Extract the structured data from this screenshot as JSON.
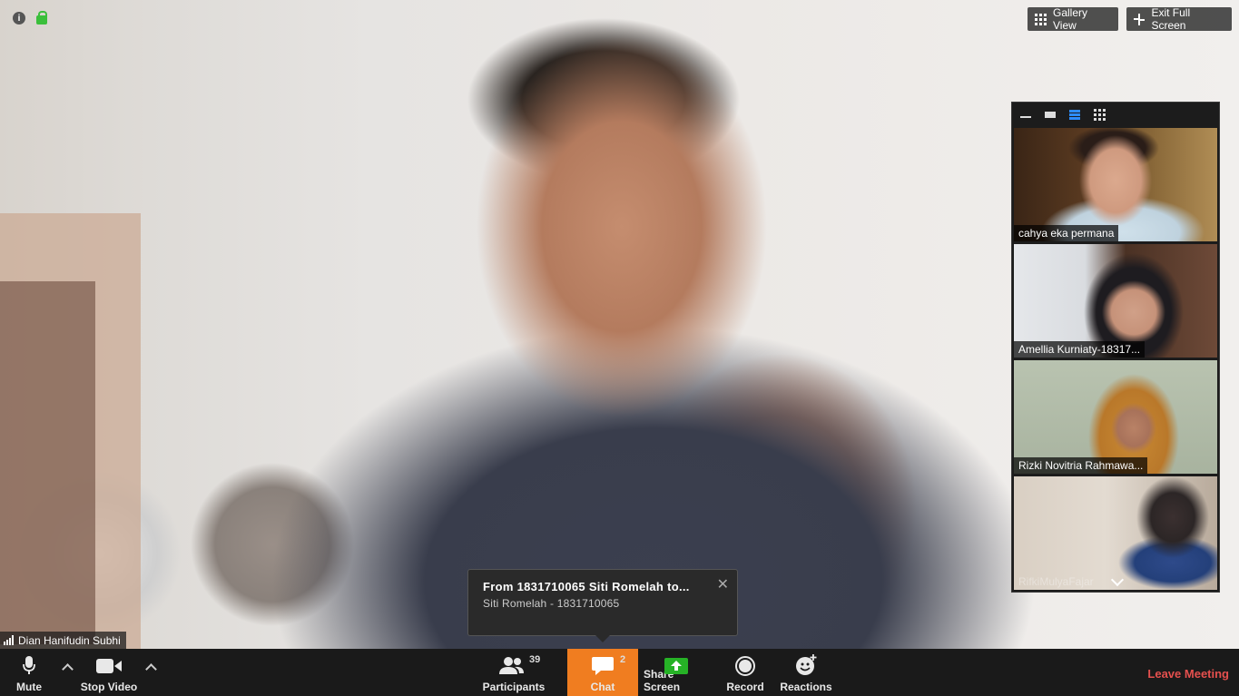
{
  "window": {
    "gallery_view_label": "Gallery View",
    "exit_full_screen_label": "Exit Full Screen"
  },
  "main_video": {
    "speaker_name": "Dian Hanifudin Subhi"
  },
  "thumbnail_strip": {
    "participants": [
      {
        "name": "cahya eka permana"
      },
      {
        "name": "Amellia Kurniaty-18317..."
      },
      {
        "name": "Rizki Novitria Rahmawa..."
      },
      {
        "name": "RifkiMulyaFajar"
      }
    ]
  },
  "chat_notification": {
    "title": "From  1831710065  Siti  Romelah  to...",
    "subtitle": "Siti Romelah - 1831710065",
    "close_glyph": "✕"
  },
  "toolbar": {
    "mute_label": "Mute",
    "stop_video_label": "Stop Video",
    "participants_label": "Participants",
    "participants_count": "39",
    "chat_label": "Chat",
    "chat_count": "2",
    "share_screen_label": "Share Screen",
    "record_label": "Record",
    "reactions_label": "Reactions",
    "leave_meeting_label": "Leave Meeting"
  },
  "colors": {
    "chat_active": "#f07d20",
    "leave_meeting": "#e5504e",
    "share_screen": "#26b226",
    "encryption_lock": "#3bbf3b"
  }
}
